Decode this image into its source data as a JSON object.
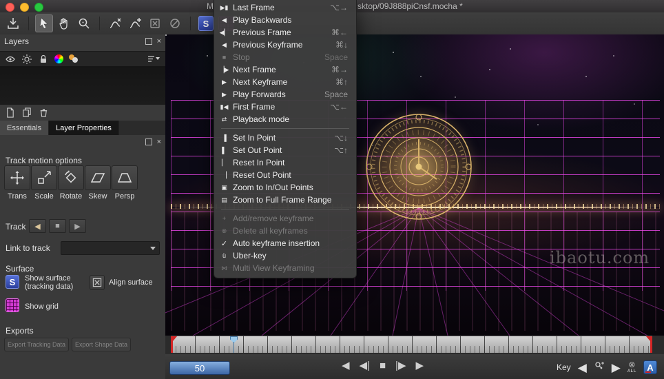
{
  "titlebar": {
    "title_left": "M",
    "title_right": "sktop/09J888piCnsf.mocha *"
  },
  "layers_panel": {
    "title": "Layers"
  },
  "tabs": {
    "essentials": "Essentials",
    "layer_properties": "Layer Properties"
  },
  "track_panel": {
    "motion_title": "Track motion options",
    "motion_buttons": [
      "Trans",
      "Scale",
      "Rotate",
      "Skew",
      "Persp"
    ],
    "track_label": "Track",
    "link_label": "Link to track",
    "surface_label": "Surface",
    "show_surface_line1": "Show surface",
    "show_surface_line2": "(tracking data)",
    "align_surface_label": "Align surface",
    "show_grid_label": "Show grid",
    "exports_label": "Exports",
    "export_tracking_label": "Export Tracking Data",
    "export_shape_label": "Export Shape Data"
  },
  "menu": {
    "items": [
      {
        "id": "last-frame",
        "icon": "last-frame",
        "label": "Last Frame",
        "shortcut": "⌥→"
      },
      {
        "id": "play-backwards",
        "icon": "play-backwards",
        "label": "Play Backwards",
        "shortcut": ""
      },
      {
        "id": "previous-frame",
        "icon": "previous-frame",
        "label": "Previous Frame",
        "shortcut": "⌘←"
      },
      {
        "id": "previous-keyframe",
        "icon": "previous-keyframe",
        "label": "Previous Keyframe",
        "shortcut": "⌘↓"
      },
      {
        "id": "stop",
        "icon": "stop",
        "label": "Stop",
        "shortcut": "Space",
        "enabled": false
      },
      {
        "id": "next-frame",
        "icon": "next-frame",
        "label": "Next Frame",
        "shortcut": "⌘→"
      },
      {
        "id": "next-keyframe",
        "icon": "next-keyframe",
        "label": "Next Keyframe",
        "shortcut": "⌘↑"
      },
      {
        "id": "play-forwards",
        "icon": "play-forwards",
        "label": "Play Forwards",
        "shortcut": "Space"
      },
      {
        "id": "first-frame",
        "icon": "first-frame",
        "label": "First Frame",
        "shortcut": "⌥←"
      },
      {
        "id": "playback-mode",
        "icon": "playback-mode",
        "label": "Playback mode",
        "shortcut": ""
      },
      {
        "sep": true
      },
      {
        "id": "set-in-point",
        "icon": "set-in",
        "label": "Set In Point",
        "shortcut": "⌥↓"
      },
      {
        "id": "set-out-point",
        "icon": "set-out",
        "label": "Set Out Point",
        "shortcut": "⌥↑"
      },
      {
        "id": "reset-in-point",
        "icon": "reset-in",
        "label": "Reset In Point",
        "shortcut": ""
      },
      {
        "id": "reset-out-point",
        "icon": "reset-out",
        "label": "Reset Out Point",
        "shortcut": ""
      },
      {
        "id": "zoom-to-in-out-points",
        "icon": "zoom-inout",
        "label": "Zoom to In/Out Points",
        "shortcut": ""
      },
      {
        "id": "zoom-to-full-frame-range",
        "icon": "zoom-full",
        "label": "Zoom to Full Frame Range",
        "shortcut": ""
      },
      {
        "sep": true
      },
      {
        "id": "add-remove-keyframe",
        "icon": "key-add",
        "label": "Add/remove keyframe",
        "shortcut": "",
        "enabled": false
      },
      {
        "id": "delete-all-keyframes",
        "icon": "key-delete",
        "label": "Delete all keyframes",
        "shortcut": "",
        "enabled": false
      },
      {
        "id": "auto-keyframe-insertion",
        "icon": "check",
        "label": "Auto keyframe insertion",
        "shortcut": "",
        "checked": true
      },
      {
        "id": "uber-key",
        "icon": "uber-key",
        "label": "Uber-key",
        "shortcut": ""
      },
      {
        "id": "multi-view-keyframing",
        "icon": "multi-view",
        "label": "Multi View Keyframing",
        "shortcut": "",
        "enabled": false
      }
    ]
  },
  "viewport": {
    "watermark": "ibaotu.com"
  },
  "timeline": {
    "frame_value": "50"
  },
  "transport": {
    "key_label": "Key",
    "all_label": "ALL",
    "autosave_label": "A"
  },
  "icons": {
    "s_label": "S"
  },
  "icon_glyphs": {
    "last-frame": "▶▮",
    "play-backwards": "◀",
    "previous-frame": "◀▏",
    "previous-keyframe": "◀",
    "stop": "■",
    "next-frame": "▕▶",
    "next-keyframe": "▶",
    "play-forwards": "▶",
    "first-frame": "▮◀",
    "playback-mode": "⇄",
    "set-in": "▐",
    "set-out": "▌",
    "reset-in": "▏",
    "reset-out": "▕",
    "zoom-inout": "▣",
    "zoom-full": "▤",
    "key-add": "+",
    "key-delete": "⊗",
    "check": "✓",
    "uber-key": "ü",
    "multi-view": "⋈",
    "track-back": "◀",
    "track-stop": "■",
    "track-fwd": "▶",
    "tr-play-back": "◀",
    "tr-step-back": "◀|",
    "tr-stop": "■",
    "tr-step-fwd": "|▶",
    "tr-play-fwd": "▶",
    "key-prev": "◀",
    "key-next": "▶",
    "all-x": "⊗"
  },
  "colors": {
    "magenta": "#d83ad8",
    "gold": "#d9b36a",
    "accent_blue": "#3d78c8"
  }
}
